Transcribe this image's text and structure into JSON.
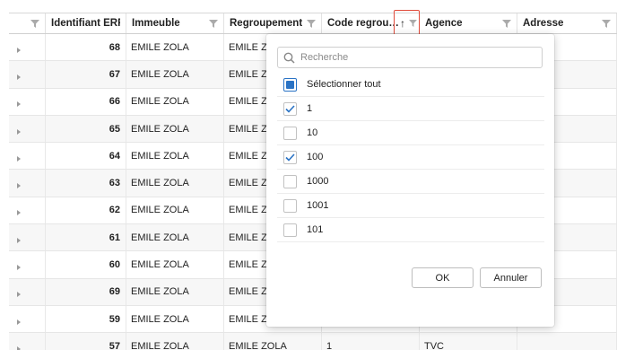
{
  "columns": [
    {
      "label": "",
      "filter_icon": "filter-icon"
    },
    {
      "label": "Identifiant ERP",
      "filter_icon": "filter-icon"
    },
    {
      "label": "Immeuble",
      "filter_icon": "filter-icon"
    },
    {
      "label": "Regroupement",
      "filter_icon": "filter-icon"
    },
    {
      "label": "Code regrou…",
      "filter_icon": "filter-icon"
    },
    {
      "label": "Agence",
      "filter_icon": "filter-icon"
    },
    {
      "label": "Adresse",
      "filter_icon": "filter-icon"
    }
  ],
  "sort": {
    "arrow": "↑",
    "icon": "sort-ascending-icon",
    "highlight_color": "#e04a3a"
  },
  "rows": [
    {
      "id": "68",
      "immeuble": "EMILE ZOLA",
      "regroupement": "EMILE ZC",
      "code": "",
      "agence": ""
    },
    {
      "id": "67",
      "immeuble": "EMILE ZOLA",
      "regroupement": "EMILE ZC",
      "code": "",
      "agence": ""
    },
    {
      "id": "66",
      "immeuble": "EMILE ZOLA",
      "regroupement": "EMILE ZC",
      "code": "",
      "agence": ""
    },
    {
      "id": "65",
      "immeuble": "EMILE ZOLA",
      "regroupement": "EMILE ZC",
      "code": "",
      "agence": ""
    },
    {
      "id": "64",
      "immeuble": "EMILE ZOLA",
      "regroupement": "EMILE ZC",
      "code": "",
      "agence": ""
    },
    {
      "id": "63",
      "immeuble": "EMILE ZOLA",
      "regroupement": "EMILE ZC",
      "code": "",
      "agence": ""
    },
    {
      "id": "62",
      "immeuble": "EMILE ZOLA",
      "regroupement": "EMILE ZC",
      "code": "",
      "agence": ""
    },
    {
      "id": "61",
      "immeuble": "EMILE ZOLA",
      "regroupement": "EMILE ZC",
      "code": "",
      "agence": ""
    },
    {
      "id": "60",
      "immeuble": "EMILE ZOLA",
      "regroupement": "EMILE ZC",
      "code": "",
      "agence": ""
    },
    {
      "id": "69",
      "immeuble": "EMILE ZOLA",
      "regroupement": "EMILE ZC",
      "code": "",
      "agence": ""
    },
    {
      "id": "59",
      "immeuble": "EMILE ZOLA",
      "regroupement": "EMILE ZC",
      "code": "",
      "agence": ""
    },
    {
      "id": "57",
      "immeuble": "EMILE ZOLA",
      "regroupement": "EMILE ZOLA",
      "code": "1",
      "agence": "TVC"
    }
  ],
  "filter_popup": {
    "search_placeholder": "Recherche",
    "select_all": {
      "label": "Sélectionner tout",
      "state": "indeterminate"
    },
    "options": [
      {
        "label": "1",
        "checked": true
      },
      {
        "label": "10",
        "checked": false
      },
      {
        "label": "100",
        "checked": true
      },
      {
        "label": "1000",
        "checked": false
      },
      {
        "label": "1001",
        "checked": false
      },
      {
        "label": "101",
        "checked": false
      }
    ],
    "ok_label": "OK",
    "cancel_label": "Annuler"
  },
  "colors": {
    "accent": "#2a73c5",
    "row_alt": "#f7f7f7",
    "border": "#e6e6e6"
  }
}
